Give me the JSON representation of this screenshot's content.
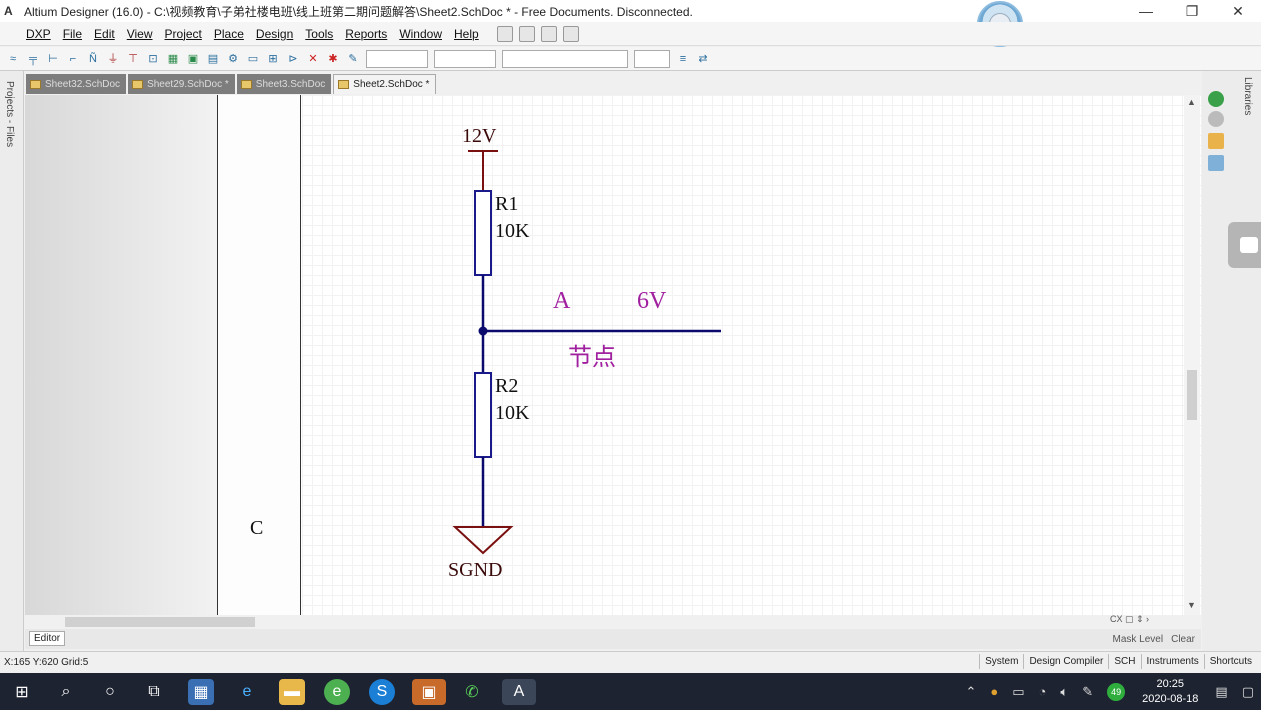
{
  "window": {
    "app_icon": "altium-icon",
    "title": "Altium Designer (16.0) - C:\\视频教育\\子弟社楼电班\\线上班第二期问题解答\\Sheet2.SchDoc * - Free Documents. Disconnected.",
    "minimize": "—",
    "maximize": "❐",
    "close": "✕"
  },
  "menu": {
    "items": [
      "DXP",
      "File",
      "Edit",
      "View",
      "Project",
      "Place",
      "Design",
      "Tools",
      "Reports",
      "Window",
      "Help"
    ]
  },
  "panels": {
    "left_label": "Projects - Files",
    "right_label": "Libraries"
  },
  "tabs": [
    {
      "label": "Sheet32.SchDoc",
      "active": false
    },
    {
      "label": "Sheet29.SchDoc *",
      "active": false
    },
    {
      "label": "Sheet3.SchDoc",
      "active": false
    },
    {
      "label": "Sheet2.SchDoc *",
      "active": true
    }
  ],
  "schematic": {
    "power_label": "12V",
    "r1_designator": "R1",
    "r1_value": "10K",
    "node_name": "A",
    "node_voltage": "6V",
    "node_caption": "节点",
    "r2_designator": "R2",
    "r2_value": "10K",
    "ground_label": "SGND",
    "zone_label": "C",
    "colors": {
      "wire": "#0b0b6e",
      "power": "#7a1010",
      "resistor": "#1a1a8a",
      "annotation": "#a020a0",
      "text": "#3a0a0a"
    }
  },
  "editor": {
    "tab_label": "Editor",
    "mask_level": "Mask Level",
    "clear": "Clear",
    "cx": "CX"
  },
  "status": {
    "coords": "X:165 Y:620   Grid:5",
    "buttons": [
      "System",
      "Design Compiler",
      "SCH",
      "Instruments",
      "Shortcuts"
    ]
  },
  "taskbar": {
    "time": "20:25",
    "date": "2020-08-18",
    "badge": "49"
  }
}
